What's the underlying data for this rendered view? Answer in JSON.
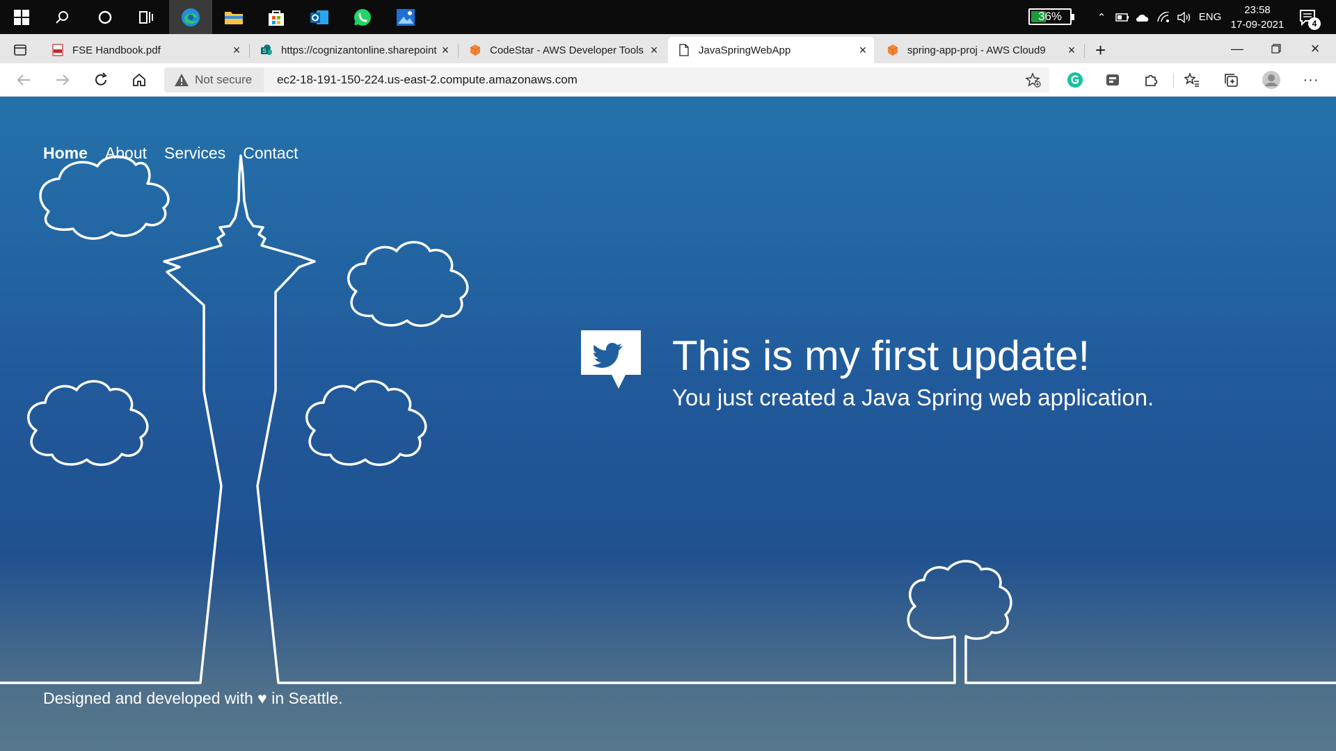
{
  "taskbar": {
    "battery_percent": "36%",
    "language": "ENG",
    "time": "23:58",
    "date": "17-09-2021",
    "notification_count": "4"
  },
  "tabs": [
    {
      "title": "FSE Handbook.pdf",
      "icon": "pdf-icon"
    },
    {
      "title": "https://cognizantonline.sharepoint",
      "icon": "sharepoint-icon"
    },
    {
      "title": "CodeStar - AWS Developer Tools",
      "icon": "aws-icon"
    },
    {
      "title": "JavaSpringWebApp",
      "icon": "page-icon"
    },
    {
      "title": "spring-app-proj - AWS Cloud9",
      "icon": "aws-icon"
    }
  ],
  "addressbar": {
    "security_label": "Not secure",
    "url": "ec2-18-191-150-224.us-east-2.compute.amazonaws.com"
  },
  "site": {
    "nav": [
      "Home",
      "About",
      "Services",
      "Contact"
    ],
    "title": "This is my first update!",
    "subtitle": "You just created a Java Spring web application.",
    "footer": "Designed and developed with ♥ in Seattle."
  },
  "colors": {
    "page_top": "#2472ab",
    "page_mid": "#20518f",
    "page_bottom": "#56788a",
    "line_art": "#ffffff"
  }
}
